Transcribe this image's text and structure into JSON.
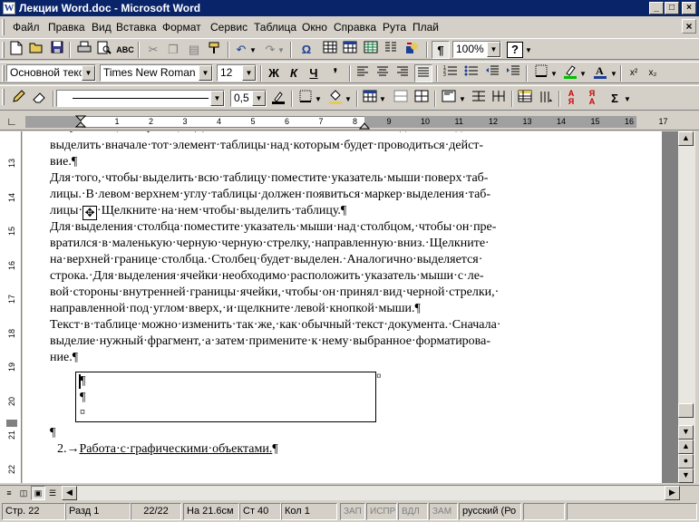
{
  "title": "Лекции Word.doc - Microsoft Word",
  "window_buttons": {
    "min": "_",
    "max": "□",
    "close": "×"
  },
  "menu": [
    "Файл",
    "Правка",
    "Вид",
    "Вставка",
    "Формат",
    "Сервис",
    "Таблица",
    "Окно",
    "Справка",
    "Рута",
    "Плай"
  ],
  "menu_close": "×",
  "standard_toolbar": {
    "zoom": "100%",
    "help": "?"
  },
  "format_toolbar": {
    "style": "Основной текст",
    "font": "Times New Roman",
    "size": "12",
    "bold": "Ж",
    "italic": "К",
    "underline": "Ч",
    "superscript": "x²",
    "subscript": "x₂"
  },
  "drawing_toolbar": {
    "line_width": "0,5",
    "sum": "Σ"
  },
  "ruler_numbers": [
    "1",
    "2",
    "3",
    "4",
    "5",
    "6",
    "7",
    "8",
    "9",
    "10",
    "11",
    "12",
    "13",
    "14",
    "15",
    "16",
    "17"
  ],
  "vruler_numbers": [
    "13",
    "14",
    "15",
    "16",
    "17",
    "18",
    "19",
    "20",
    "21",
    "22"
  ],
  "document": {
    "line1": "выделить·вначале·тот·элемент·таблицы·над·которым·будет·проводиться·дейст-",
    "line2": "вие.¶",
    "line3": "Для·того,·чтобы·выделить·всю·таблицу·поместите·указатель·мыши·поверх·таб-",
    "line4": "лицы.·В·левом·верхнем·углу·таблицы·должен·появиться·маркер·выделения·таб-",
    "line5a": "лицы·",
    "line5b": "·Щелкните·на·нем·чтобы·выделить·таблицу.¶",
    "line6": "Для·выделения·столбца·поместите·указатель·мыши·над·столбцом,·чтобы·он·пре-",
    "line7": "вратился·в·маленькую·черную·черную·стрелку,·направленную·вниз.·Щелкните·",
    "line8": "на·верхней·границе·столбца.·Столбец·будет·выделен.·Аналогично·выделяется·",
    "line9": "строка.·Для·выделения·ячейки·необходимо·расположить·указатель·мыши·с·ле-",
    "line10": "вой·стороны·внутренней·границы·ячейки,·чтобы·он·принял·вид·черной·стрелки,·",
    "line11": "направленной·под·углом·вверх,·и·щелкните·левой·кнопкой·мыши.¶",
    "line12": "Текст·в·таблице·можно·изменить·так·же,·как·обычный·текст·документа.·Сначала·",
    "line13": "выделие·нужный·фрагмент,·а·затем·примените·к·нему·выбранное·форматирова-",
    "line14": "ние.¶",
    "cell1": "¶",
    "cell2": "¶",
    "cell3": "¤",
    "end_mark": "¤",
    "after_table": "¶",
    "list_number": "2.→",
    "list_text": "Работа·с·графическими·объектами.",
    "list_pilcrow": "¶"
  },
  "status": {
    "page": "Стр. 22",
    "section": "Разд 1",
    "pages": "22/22",
    "position": "На 21.6см",
    "line": "Ст 40",
    "col": "Кол 1",
    "rec": "ЗАП",
    "trk": "ИСПР",
    "ext": "ВДЛ",
    "ovr": "ЗАМ",
    "lang": "русский (Ро"
  }
}
